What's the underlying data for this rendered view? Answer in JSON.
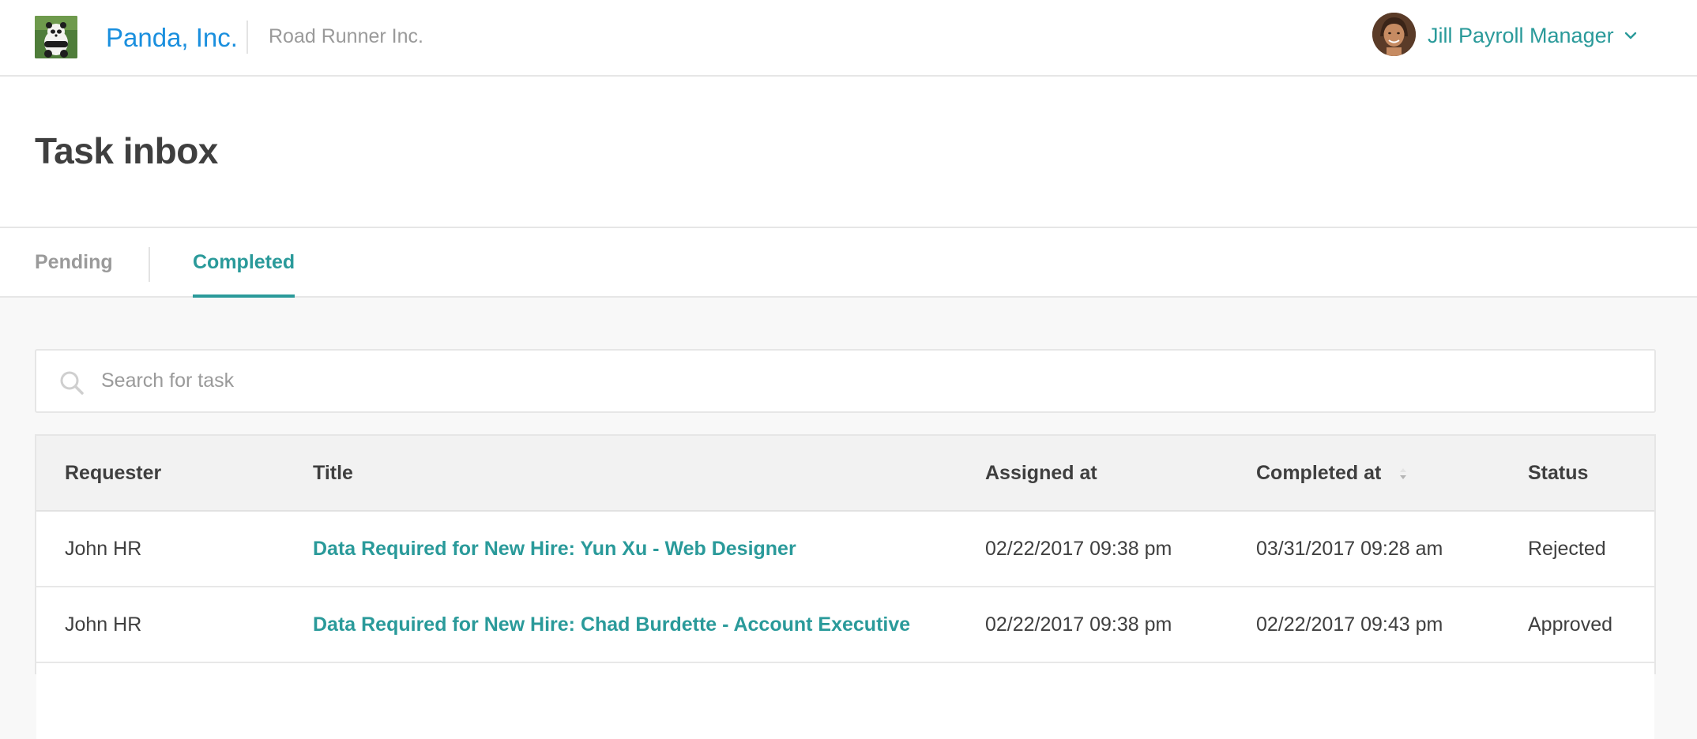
{
  "colors": {
    "accent": "#2a9a9a",
    "brand_blue": "#1a8fde",
    "muted_text": "#9a9a9a",
    "body_text": "#3f3f3f"
  },
  "header": {
    "logo_icon": "panda-logo",
    "brand": "Panda, Inc.",
    "company": "Road Runner Inc.",
    "user_name": "Jill Payroll Manager",
    "user_menu_icon": "chevron-down-icon"
  },
  "page": {
    "title": "Task inbox"
  },
  "tabs": [
    {
      "label": "Pending",
      "active": false
    },
    {
      "label": "Completed",
      "active": true
    }
  ],
  "search": {
    "placeholder": "Search for task",
    "value": "",
    "icon": "search-icon"
  },
  "table": {
    "columns": [
      "Requester",
      "Title",
      "Assigned at",
      "Completed at",
      "Status"
    ],
    "sorted_column": "Completed at",
    "rows": [
      {
        "requester": "John HR",
        "title": "Data Required for New Hire: Yun Xu - Web Designer",
        "assigned_at": "02/22/2017 09:38 pm",
        "completed_at": "03/31/2017 09:28 am",
        "status": "Rejected"
      },
      {
        "requester": "John HR",
        "title": "Data Required for New Hire: Chad Burdette - Account Executive",
        "assigned_at": "02/22/2017 09:38 pm",
        "completed_at": "02/22/2017 09:43 pm",
        "status": "Approved"
      },
      {
        "requester": "",
        "title": "",
        "assigned_at": "",
        "completed_at": "",
        "status": ""
      }
    ]
  }
}
